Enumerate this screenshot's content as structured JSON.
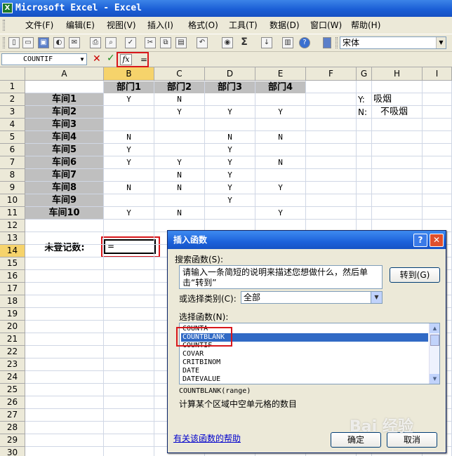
{
  "window": {
    "title": "Microsoft Excel - Excel",
    "icon": "excel-icon"
  },
  "menu": [
    "文件(F)",
    "编辑(E)",
    "视图(V)",
    "插入(I)",
    "格式(O)",
    "工具(T)",
    "数据(D)",
    "窗口(W)",
    "帮助(H)"
  ],
  "toolbar": {
    "font_name": "宋体"
  },
  "formula_bar": {
    "name_box": "COUNTIF",
    "fx_label": "fx",
    "formula": "="
  },
  "columns": [
    "A",
    "B",
    "C",
    "D",
    "E",
    "F",
    "G",
    "H",
    "I"
  ],
  "rows": [
    "1",
    "2",
    "3",
    "4",
    "5",
    "6",
    "7",
    "8",
    "9",
    "10",
    "11",
    "12",
    "13",
    "14",
    "15",
    "16",
    "17",
    "18",
    "19",
    "20",
    "21",
    "22",
    "23",
    "24",
    "25",
    "26",
    "27",
    "28",
    "29",
    "30"
  ],
  "sheet": {
    "headers": [
      "部门1",
      "部门2",
      "部门3",
      "部门4"
    ],
    "workshops": [
      "车间1",
      "车间2",
      "车间3",
      "车间4",
      "车间5",
      "车间6",
      "车间7",
      "车间8",
      "车间9",
      "车间10"
    ],
    "values": [
      [
        "Y",
        "N",
        "",
        ""
      ],
      [
        "",
        "Y",
        "Y",
        "Y"
      ],
      [
        "",
        "",
        "",
        ""
      ],
      [
        "N",
        "",
        "N",
        "N"
      ],
      [
        "Y",
        "",
        "Y",
        ""
      ],
      [
        "Y",
        "Y",
        "Y",
        "N"
      ],
      [
        "",
        "N",
        "Y",
        ""
      ],
      [
        "N",
        "N",
        "Y",
        "Y"
      ],
      [
        "",
        "",
        "Y",
        ""
      ],
      [
        "Y",
        "N",
        "",
        "Y"
      ]
    ],
    "legend": [
      {
        "key": "Y:",
        "text": "吸烟"
      },
      {
        "key": "N:",
        "text": "不吸烟"
      }
    ],
    "count_label": "未登记数:",
    "active_cell_value": "="
  },
  "dialog": {
    "title": "插入函数",
    "search_label": "搜索函数(S):",
    "search_text": "请输入一条简短的说明来描述您想做什么，然后单击“转到”",
    "go_button": "转到(G)",
    "category_label": "或选择类别(C):",
    "category": "全部",
    "select_label": "选择函数(N):",
    "functions": [
      "COUNTA",
      "COUNTBLANK",
      "COUNTIF",
      "COVAR",
      "CRITBINOM",
      "DATE",
      "DATEVALUE"
    ],
    "selected_function": "COUNTBLANK",
    "syntax": "COUNTBLANK(range)",
    "description": "计算某个区域中空单元格的数目",
    "help_link": "有关该函数的帮助",
    "ok_button": "确定",
    "cancel_button": "取消"
  },
  "watermark": "Bai 经验"
}
